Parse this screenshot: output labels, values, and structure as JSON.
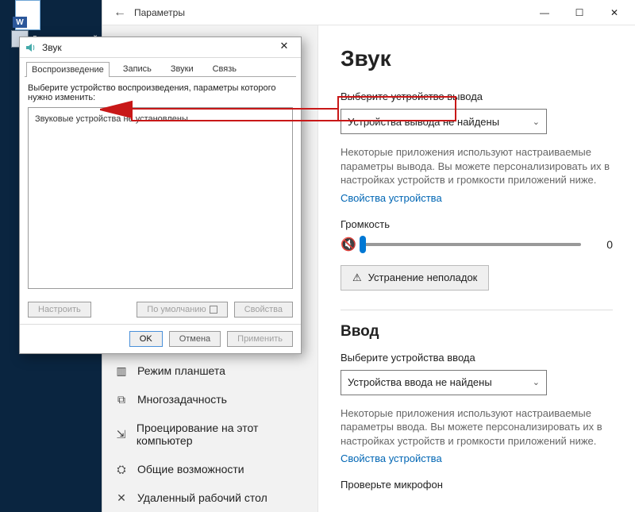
{
  "desktop": {
    "devmgr": "Диспетчер устройств"
  },
  "settings": {
    "back": "←",
    "title": "Параметры",
    "winbtns": {
      "min": "—",
      "max": "☐",
      "close": "✕"
    },
    "sidebar": [
      {
        "icon": "▥",
        "label": "Режим планшета"
      },
      {
        "icon": "⧉",
        "label": "Многозадачность"
      },
      {
        "icon": "⇲",
        "label": "Проецирование на этот компьютер"
      },
      {
        "icon": "⛭",
        "label": "Общие возможности"
      },
      {
        "icon": "✕",
        "label": "Удаленный рабочий стол"
      }
    ]
  },
  "content": {
    "h1": "Звук",
    "out_label": "Выберите устройство вывода",
    "out_select": "Устройства вывода не найдены",
    "out_hint": "Некоторые приложения используют настраиваемые параметры вывода. Вы можете персонализировать их в настройках устройств и громкости приложений ниже.",
    "out_link": "Свойства устройства",
    "vol_label": "Громкость",
    "vol_icon": "🔇",
    "vol_value": "0",
    "troubleshoot": "Устранение неполадок",
    "h2_in": "Ввод",
    "in_label": "Выберите устройства ввода",
    "in_select": "Устройства ввода не найдены",
    "in_hint": "Некоторые приложения используют настраиваемые параметры ввода. Вы можете персонализировать их в настройках устройств и громкости приложений ниже.",
    "in_link": "Свойства устройства",
    "check_mic": "Проверьте микрофон"
  },
  "sound_dlg": {
    "title": "Звук",
    "close": "✕",
    "tabs": [
      "Воспроизведение",
      "Запись",
      "Звуки",
      "Связь"
    ],
    "instruction": "Выберите устройство воспроизведения, параметры которого нужно изменить:",
    "placeholder": "Звуковые устройства не установлены",
    "btn_configure": "Настроить",
    "btn_default": "По умолчанию",
    "btn_properties": "Свойства",
    "btn_ok": "OK",
    "btn_cancel": "Отмена",
    "btn_apply": "Применить"
  }
}
